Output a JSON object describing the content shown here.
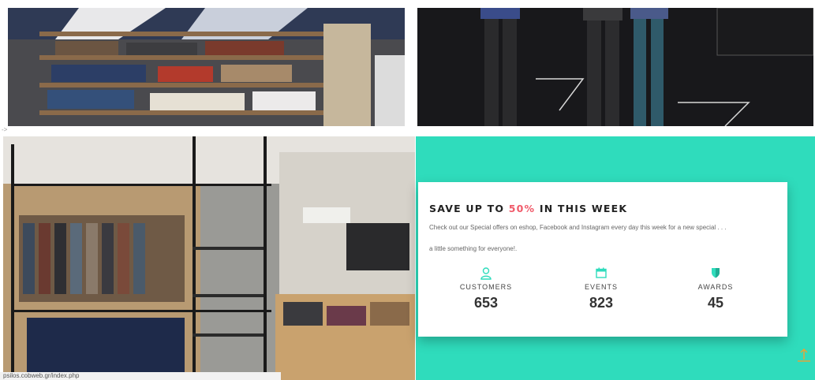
{
  "promo": {
    "title_prefix": "SAVE UP TO ",
    "title_highlight": "50%",
    "title_suffix": " IN THIS WEEK",
    "description": "Check out our Special offers on eshop, Facebook and Instagram every day this week for a new special . . .",
    "description2": "a little something for everyone!."
  },
  "stats": [
    {
      "icon": "user-icon",
      "label": "CUSTOMERS",
      "value": "653"
    },
    {
      "icon": "calendar-icon",
      "label": "EVENTS",
      "value": "823"
    },
    {
      "icon": "shield-icon",
      "label": "AWARDS",
      "value": "45"
    }
  ],
  "status_bar": {
    "url": "psilos.cobweb.gr/index.php"
  },
  "arrow_mark": "->",
  "colors": {
    "teal": "#2fdcbc",
    "highlight": "#f05a6a"
  }
}
